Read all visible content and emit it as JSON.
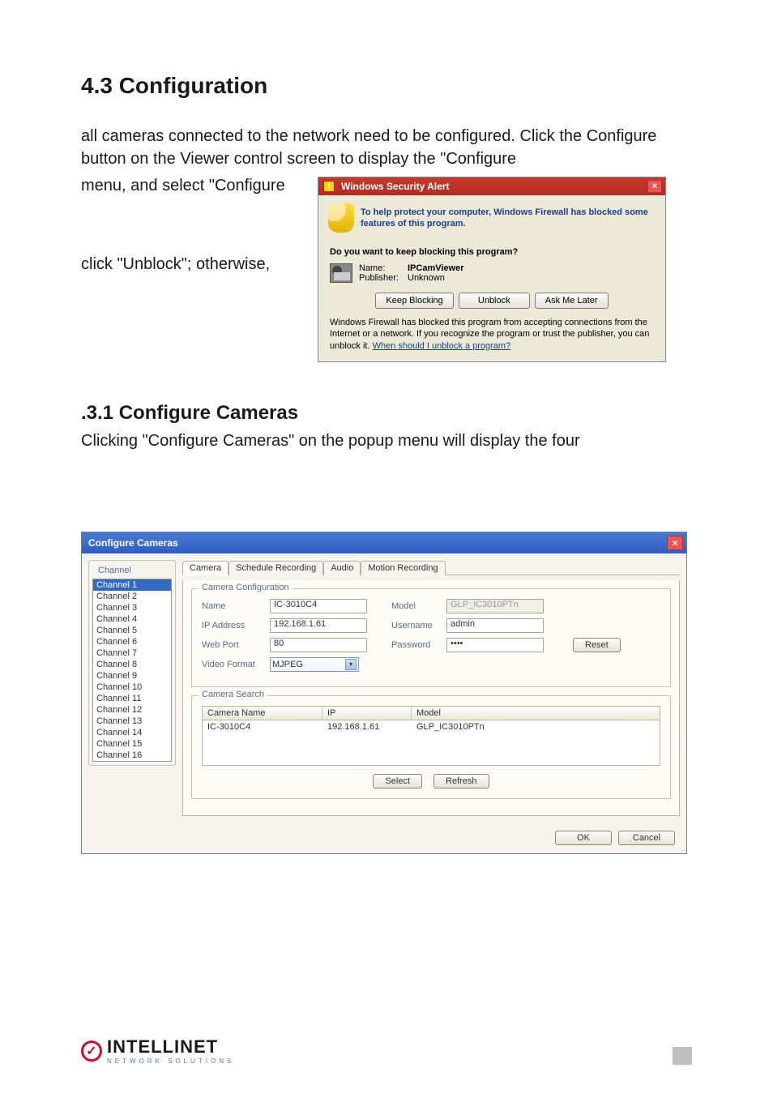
{
  "section": {
    "heading_main": "4.3  Configuration",
    "para1": "all cameras connected to the network need to be configured. Click the Configure button on the Viewer control screen to display the \"Configure",
    "line_left1": "menu, and select \"Configure",
    "line_left2": "click \"Unblock\"; otherwise,",
    "heading_sub": ".3.1  Configure Cameras",
    "para2": "Clicking \"Configure Cameras\" on the popup menu will display the four"
  },
  "wsa": {
    "title": "Windows Security Alert",
    "band": "To help protect your computer, Windows Firewall has blocked some features of this program.",
    "question": "Do you want to keep blocking this program?",
    "name_label": "Name:",
    "name_value": "IPCamViewer",
    "publisher_label": "Publisher:",
    "publisher_value": "Unknown",
    "btn_keep": "Keep Blocking",
    "btn_unblock": "Unblock",
    "btn_ask": "Ask Me Later",
    "footer_text": "Windows Firewall has blocked this program from accepting connections from the Internet or a network. If you recognize the program or trust the publisher, you can unblock it. ",
    "footer_link": "When should I unblock a program?"
  },
  "cc": {
    "title": "Configure Cameras",
    "channel_group": "Channel",
    "channels": [
      "Channel 1",
      "Channel 2",
      "Channel 3",
      "Channel 4",
      "Channel 5",
      "Channel 6",
      "Channel 7",
      "Channel 8",
      "Channel 9",
      "Channel 10",
      "Channel 11",
      "Channel 12",
      "Channel 13",
      "Channel 14",
      "Channel 15",
      "Channel 16"
    ],
    "tabs": [
      "Camera",
      "Schedule Recording",
      "Audio",
      "Motion Recording"
    ],
    "fs_config": "Camera Configuration",
    "lbl_name": "Name",
    "val_name": "IC-3010C4",
    "lbl_model": "Model",
    "val_model": "GLP_IC3010PTn",
    "lbl_ip": "IP Address",
    "val_ip": "192.168.1.61",
    "lbl_user": "Username",
    "val_user": "admin",
    "lbl_port": "Web Port",
    "val_port": "80",
    "lbl_pass": "Password",
    "val_pass": "••••",
    "lbl_format": "Video Format",
    "val_format": "MJPEG",
    "btn_reset": "Reset",
    "fs_search": "Camera Search",
    "col_name": "Camera Name",
    "col_ip": "IP",
    "col_model": "Model",
    "row_name": "IC-3010C4",
    "row_ip": "192.168.1.61",
    "row_model": "GLP_IC3010PTn",
    "btn_select": "Select",
    "btn_refresh": "Refresh",
    "btn_ok": "OK",
    "btn_cancel": "Cancel"
  },
  "footer": {
    "logo_main": "INTELLINET",
    "logo_sub": "NETWORK SOLUTIONS"
  }
}
